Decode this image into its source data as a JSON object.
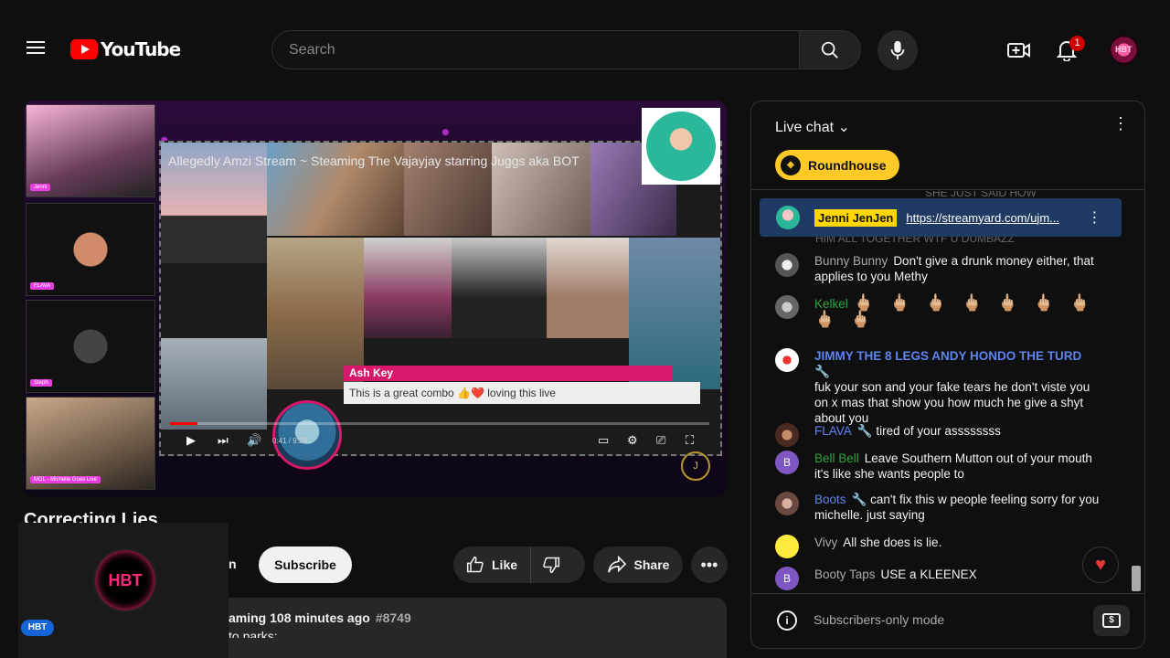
{
  "header": {
    "logo_text": "YouTube",
    "search_placeholder": "Search",
    "notification_count": "1",
    "avatar_text": "HBT"
  },
  "player": {
    "stream_title": "Allegedly Amzi Stream ~ Steaming The Vajayjay starring Juggs aka BOT",
    "time": "0:41 / 9:29",
    "progress": 0.05,
    "tiles": [
      {
        "label": "Jenni"
      },
      {
        "label": "FLAVA"
      },
      {
        "label": "Steph"
      },
      {
        "label": "MGL - Michelle Goes Live"
      }
    ],
    "overlay_comment": {
      "name": "Ash Key",
      "text": "This is a great combo 👍❤️ loving this live"
    },
    "coin_text": "J"
  },
  "video": {
    "title": "Correcting Lies",
    "join_fragment": "n",
    "subscribe_label": "Subscribe",
    "like_label": "Like",
    "share_label": "Share",
    "stream_info": "aming 108 minutes ago",
    "stream_tag": "#8749",
    "desc_line2": "to parks:"
  },
  "mini_player": {
    "logo_text": "HBT",
    "badge": "HBT"
  },
  "chat": {
    "title": "Live chat",
    "chip_label": "Roundhouse",
    "pinned": {
      "name": "Jenni JenJen",
      "link": "https://streamyard.com/ujm..."
    },
    "faded_top": "SHE JUST SAID HOW",
    "faded_line": "HIM ALL TOGETHER WTF U DUMBAZZ",
    "messages": [
      {
        "author": "Bunny Bunny",
        "text": "Don't give a drunk money either, that applies to you Methy"
      },
      {
        "author": "Kelkel",
        "text": "🖕🏼 🖕🏼 🖕🏼 🖕🏼 🖕🏼 🖕🏼 🖕🏼 🖕🏼 🖕🏼"
      },
      {
        "author": "JIMMY THE 8 LEGS ANDY HONDO THE TURD",
        "text": "fuk your son and your fake tears he don't viste you on x mas that show you how much he give a shyt about you"
      },
      {
        "author": "FLAVA",
        "text": "tired of your assssssss"
      },
      {
        "author": "Bell Bell",
        "text": "Leave Southern Mutton out of your mouth it's like she wants people to"
      },
      {
        "author": "Boots",
        "text": "can't fix this w people feeling sorry for you michelle. just saying"
      },
      {
        "author": "Vivy",
        "text": "All she does is lie."
      },
      {
        "author": "Booty Taps",
        "text": "USE a KLEENEX"
      }
    ],
    "footer_text": "Subscribers-only mode"
  }
}
